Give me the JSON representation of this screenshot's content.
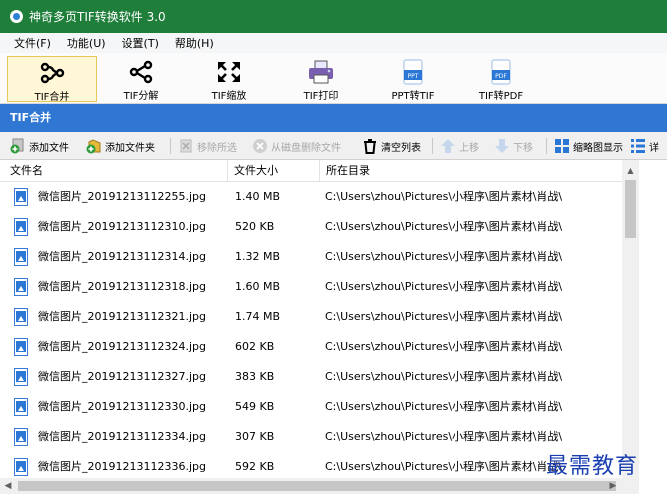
{
  "window": {
    "title": "神奇多页TIF转换软件 3.0"
  },
  "menu": [
    {
      "label": "文件(F)"
    },
    {
      "label": "功能(U)"
    },
    {
      "label": "设置(T)"
    },
    {
      "label": "帮助(H)"
    }
  ],
  "ribbon": {
    "tabs": [
      {
        "label": "TIF合并",
        "icon": "merge-icon",
        "active": true
      },
      {
        "label": "TIF分解",
        "icon": "split-icon",
        "active": false
      },
      {
        "label": "TIF缩放",
        "icon": "resize-icon",
        "active": false
      },
      {
        "label": "TIF打印",
        "icon": "printer-icon",
        "active": false
      },
      {
        "label": "PPT转TIF",
        "icon": "ppt-icon",
        "active": false
      },
      {
        "label": "TIF转PDF",
        "icon": "pdf-icon",
        "active": false
      }
    ],
    "ppt_badge": "PPT",
    "pdf_badge": "PDF"
  },
  "section": {
    "title": "TIF合并"
  },
  "toolbar": {
    "add_file": "添加文件",
    "add_folder": "添加文件夹",
    "remove_selected": "移除所选",
    "delete_from_disk": "从磁盘删除文件",
    "clear_list": "清空列表",
    "move_up": "上移",
    "move_down": "下移",
    "thumbnail_view": "缩略图显示",
    "detail_view": "详"
  },
  "table": {
    "columns": [
      "文件名",
      "文件大小",
      "所在目录"
    ],
    "rows": [
      {
        "name": "微信图片_20191213112255.jpg",
        "size": "1.40 MB",
        "path": "C:\\Users\\zhou\\Pictures\\小程序\\图片素材\\肖战\\"
      },
      {
        "name": "微信图片_20191213112310.jpg",
        "size": "520 KB",
        "path": "C:\\Users\\zhou\\Pictures\\小程序\\图片素材\\肖战\\"
      },
      {
        "name": "微信图片_20191213112314.jpg",
        "size": "1.32 MB",
        "path": "C:\\Users\\zhou\\Pictures\\小程序\\图片素材\\肖战\\"
      },
      {
        "name": "微信图片_20191213112318.jpg",
        "size": "1.60 MB",
        "path": "C:\\Users\\zhou\\Pictures\\小程序\\图片素材\\肖战\\"
      },
      {
        "name": "微信图片_20191213112321.jpg",
        "size": "1.74 MB",
        "path": "C:\\Users\\zhou\\Pictures\\小程序\\图片素材\\肖战\\"
      },
      {
        "name": "微信图片_20191213112324.jpg",
        "size": "602 KB",
        "path": "C:\\Users\\zhou\\Pictures\\小程序\\图片素材\\肖战\\"
      },
      {
        "name": "微信图片_20191213112327.jpg",
        "size": "383 KB",
        "path": "C:\\Users\\zhou\\Pictures\\小程序\\图片素材\\肖战\\"
      },
      {
        "name": "微信图片_20191213112330.jpg",
        "size": "549 KB",
        "path": "C:\\Users\\zhou\\Pictures\\小程序\\图片素材\\肖战\\"
      },
      {
        "name": "微信图片_20191213112334.jpg",
        "size": "307 KB",
        "path": "C:\\Users\\zhou\\Pictures\\小程序\\图片素材\\肖战\\"
      },
      {
        "name": "微信图片_20191213112336.jpg",
        "size": "592 KB",
        "path": "C:\\Users\\zhou\\Pictures\\小程序\\图片素材\\肖战\\"
      }
    ]
  },
  "watermark": "最需教育",
  "colors": {
    "titlebar": "#1e7e3a",
    "section": "#3077d3",
    "accent": "#2a77d6"
  }
}
